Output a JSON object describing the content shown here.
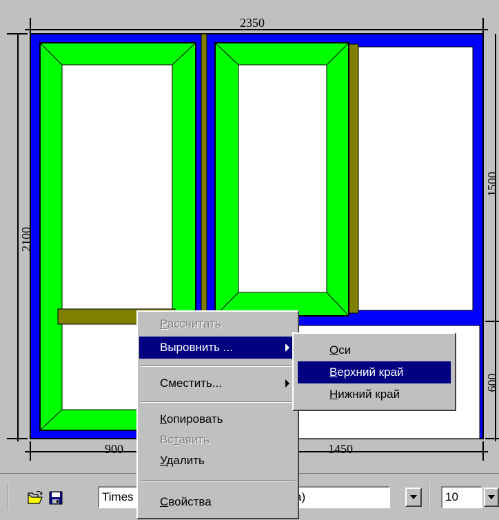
{
  "dimensions": {
    "top": "2350",
    "left": "2100",
    "right_upper": "1500",
    "right_lower": "600",
    "bottom_left": "900",
    "bottom_right": "1450"
  },
  "colors": {
    "frame": "#0000ff",
    "sash": "#00ff00",
    "mullion": "#808000",
    "glass": "#ffffff",
    "menu_highlight": "#000080"
  },
  "context_menu": {
    "items": [
      {
        "label": "Рассчитать",
        "accel": "Р",
        "rest": "ассчитать",
        "state": "disabled"
      },
      {
        "label": "Выровнить ...",
        "accel": "",
        "rest": "Выровнить ...",
        "state": "highlighted",
        "submenu": true
      },
      {
        "label": "Сместить...",
        "accel": "",
        "rest": "Сместить...",
        "state": "normal",
        "submenu": true
      },
      {
        "label": "Копировать",
        "accel": "К",
        "rest": "опировать",
        "state": "normal"
      },
      {
        "label": "Вставить",
        "pre": "Вс",
        "accel": "т",
        "rest": "авить",
        "state": "disabled"
      },
      {
        "label": "Удалить",
        "accel": "У",
        "rest": "далить",
        "state": "normal"
      },
      {
        "label": "Свойства",
        "accel": "С",
        "rest": "войства",
        "state": "normal"
      }
    ]
  },
  "align_submenu": {
    "items": [
      {
        "label": "Оси",
        "accel": "О",
        "rest": "си",
        "state": "normal"
      },
      {
        "label": "Верхний край",
        "accel": "В",
        "rest": "ерхний край",
        "state": "highlighted"
      },
      {
        "label": "Нижний край",
        "accel": "Н",
        "rest": "ижний край",
        "state": "normal"
      }
    ]
  },
  "toolbar": {
    "open_icon": "open-folder-icon",
    "save_icon": "floppy-disk-icon",
    "font_name_left": "Times",
    "font_name_right": "a)",
    "font_size": "10"
  }
}
